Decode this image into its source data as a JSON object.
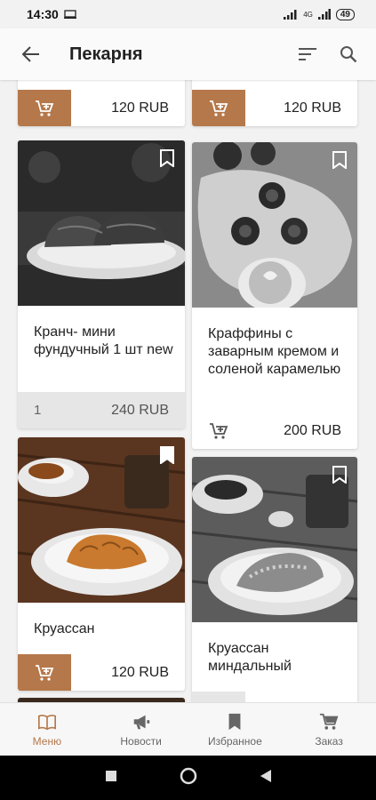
{
  "status": {
    "time": "14:30",
    "network": "4G",
    "battery": "49"
  },
  "appbar": {
    "title": "Пекарня"
  },
  "products": [
    {
      "name": "",
      "price": "120 RUB"
    },
    {
      "name": "",
      "price": "120 RUB"
    },
    {
      "name": "Кранч- мини фундучный 1 шт new",
      "price": "240 RUB",
      "quantity": "1"
    },
    {
      "name": "Краффины с заварным кремом и соленой карамелью",
      "price": "200 RUB"
    },
    {
      "name": "Круассан",
      "price": "120 RUB"
    },
    {
      "name": "Круассан миндальный",
      "price": ""
    }
  ],
  "nav": [
    {
      "label": "Меню",
      "icon": "book-icon",
      "active": true
    },
    {
      "label": "Новости",
      "icon": "megaphone-icon"
    },
    {
      "label": "Избранное",
      "icon": "bookmark-icon"
    },
    {
      "label": "Заказ",
      "icon": "cart-icon"
    }
  ],
  "colors": {
    "accent": "#b5784a",
    "background": "#f2f2f2"
  }
}
